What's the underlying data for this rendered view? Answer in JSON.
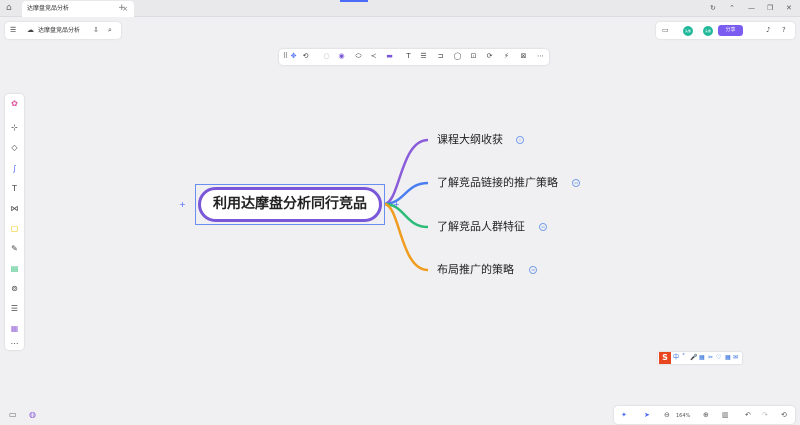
{
  "window": {
    "tab_title": "达摩盘竞品分析",
    "tab_close": "×",
    "tab_add": "+",
    "controls": [
      "↻",
      "⌃",
      "—",
      "❐",
      "✕"
    ]
  },
  "header": {
    "menu_icon": "☰",
    "cloud_icon": "☁",
    "doc_title": "达摩盘竞品分析",
    "download_icon": "⇩",
    "search_icon": "⌕"
  },
  "header_right": {
    "present_icon": "▭",
    "avatars": [
      "头像",
      "头像"
    ],
    "share_label": "分享",
    "bell_icon": "♪",
    "help_icon": "?"
  },
  "toolbar": {
    "icons": [
      "⠿",
      "✥",
      "⟲",
      "○",
      "◉",
      "⬭",
      "≺",
      "▬",
      "T",
      "☰",
      "⊐",
      "◯",
      "⊡",
      "⟳",
      "⚡",
      "⊠",
      "⋯"
    ]
  },
  "left_toolbar": {
    "icons": [
      "✿",
      "⊹",
      "◇",
      "∫",
      "T",
      "⋈",
      "▢",
      "✎",
      "▤",
      "⊚",
      "☰",
      "▦",
      "⋯"
    ]
  },
  "bottom_left": [
    "▭",
    "◍"
  ],
  "bottom_bar": {
    "ai_icon": "✦",
    "cursor_icon": "➤",
    "zoom_out": "⊖",
    "zoom_value": "164%",
    "zoom_in": "⊕",
    "map_icon": "▥",
    "undo": "↶",
    "redo": "↷",
    "history": "⟲"
  },
  "ime": {
    "logo": "S",
    "items": [
      "中",
      "˚",
      "🎤",
      "▦",
      "✂",
      "♡",
      "▦",
      "✉"
    ]
  },
  "mindmap": {
    "central": "利用达摩盘分析同行竞品",
    "plus": "+",
    "branches": [
      {
        "text": "课程大纲收获",
        "badge": "1",
        "color": "#8a5cd9"
      },
      {
        "text": "了解竞品链接的推广策略",
        "badge": "13",
        "color": "#4a7ef0"
      },
      {
        "text": "了解竞品人群特征",
        "badge": "11",
        "color": "#2dbb78"
      },
      {
        "text": "布局推广的策略",
        "badge": "16",
        "color": "#f09c1e"
      }
    ]
  }
}
